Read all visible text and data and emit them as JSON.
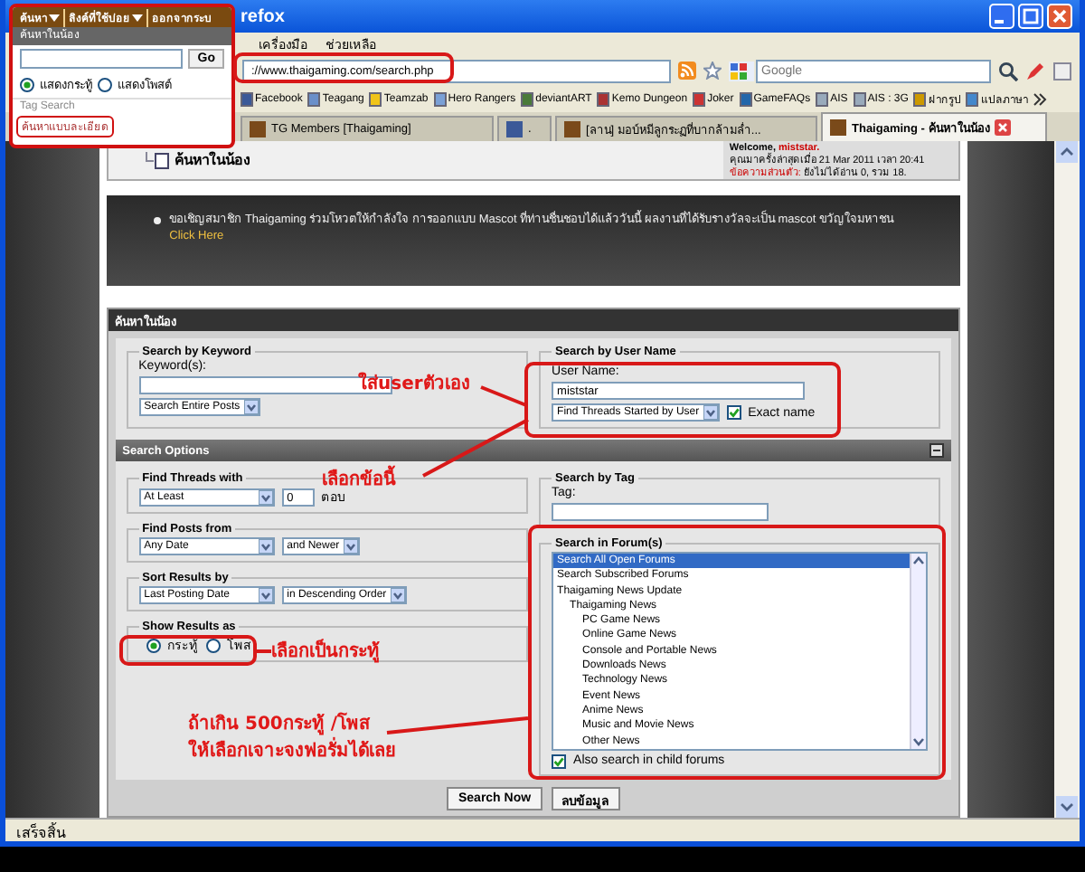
{
  "window": {
    "title": "refox"
  },
  "menu": [
    "เครื่องมือ",
    "ช่วยเหลือ"
  ],
  "address": "://www.thaigaming.com/search.php",
  "search_box": {
    "placeholder": "Google"
  },
  "bookmarks": [
    {
      "label": "Facebook"
    },
    {
      "label": "Teagang"
    },
    {
      "label": "Teamzab"
    },
    {
      "label": "Hero Rangers"
    },
    {
      "label": "deviantART"
    },
    {
      "label": "Kemo Dungeon"
    },
    {
      "label": "Joker"
    },
    {
      "label": "GameFAQs"
    },
    {
      "label": "AIS"
    },
    {
      "label": "AIS : 3G"
    },
    {
      "label": "ฝากรูป"
    },
    {
      "label": "แปลภาษา"
    }
  ],
  "tabs": [
    {
      "label": "TG Members [Thaigaming]",
      "selected": false
    },
    {
      "label": ".",
      "selected": false
    },
    {
      "label": "[ลาน] มอบ์หมีลูกระฏที่บากล้ามล่ำ...",
      "selected": false
    },
    {
      "label": "Thaigaming - ค้นหาในน้อง",
      "selected": true
    }
  ],
  "page": {
    "breadcrumb": "ค้นหาในน้อง",
    "welcome": {
      "greeting": "Welcome,",
      "user": "miststar.",
      "last_visit": "คุณมาครั้งล่าสุดเมื่อ 21 Mar 2011 เวลา 20:41",
      "messages_label": "ข้อความส่วนตัว:",
      "messages": "ยังไม่ได้อ่าน 0, รวม 18."
    },
    "notice": {
      "text": "ขอเชิญสมาชิก Thaigaming ร่วมโหวตให้กำลังใจ การออกแบบ Mascot ที่ท่านชื่นชอบได้แล้ววันนี้ ผลงานที่ได้รับรางวัลจะเป็น mascot ขวัญใจมหาชน",
      "link": "Click Here"
    }
  },
  "form": {
    "title": "ค้นหาในน้อง",
    "keyword": {
      "legend": "Search by Keyword",
      "label": "Keyword(s):",
      "scope": "Search Entire Posts"
    },
    "user": {
      "legend": "Search by User Name",
      "label": "User Name:",
      "value": "miststar",
      "mode": "Find Threads Started by User",
      "exact": {
        "label": "Exact name",
        "checked": true
      }
    },
    "options_title": "Search Options",
    "threads": {
      "legend": "Find Threads with",
      "compare": "At Least",
      "count": "0",
      "unit": "ตอบ"
    },
    "posts_from": {
      "legend": "Find Posts from",
      "date": "Any Date",
      "direction": "and Newer"
    },
    "sort": {
      "legend": "Sort Results by",
      "field": "Last Posting Date",
      "order": "in Descending Order"
    },
    "show_as": {
      "legend": "Show Results as",
      "options": [
        {
          "label": "กระทู้",
          "selected": true
        },
        {
          "label": "โพส",
          "selected": false
        }
      ]
    },
    "tag": {
      "legend": "Search by Tag",
      "label": "Tag:"
    },
    "forums": {
      "legend": "Search in Forum(s)",
      "items": [
        {
          "label": "Search All Open Forums",
          "selected": true
        },
        {
          "label": "Search Subscribed Forums",
          "selected": false
        },
        {
          "label": "Thaigaming News Update",
          "selected": false,
          "children": [
            {
              "label": "Thaigaming News",
              "selected": false,
              "children": [
                {
                  "label": "PC Game News",
                  "selected": false
                },
                {
                  "label": "Online Game News",
                  "selected": false
                },
                {
                  "label": "Console and Portable News",
                  "selected": false
                },
                {
                  "label": "Downloads News",
                  "selected": false
                },
                {
                  "label": "Technology News",
                  "selected": false
                },
                {
                  "label": "Event News",
                  "selected": false
                },
                {
                  "label": "Anime News",
                  "selected": false
                },
                {
                  "label": "Music and Movie News",
                  "selected": false
                },
                {
                  "label": "Other News",
                  "selected": false
                }
              ]
            }
          ]
        }
      ],
      "child": {
        "label": "Also search in child forums",
        "checked": true
      }
    },
    "buttons": [
      "Search Now",
      "ลบข้อมูล"
    ]
  },
  "popup": {
    "menu": [
      {
        "label": "ค้นหา",
        "dropdown": true
      },
      {
        "label": "ลิงค์ที่ใช้บ่อย",
        "dropdown": true
      },
      {
        "label": "ออกจากระบ",
        "dropdown": false
      }
    ],
    "title": "ค้นหาในน้อง",
    "go": "Go",
    "options": [
      {
        "label": "แสดงกระทู้",
        "selected": true
      },
      {
        "label": "แสดงโพสต์",
        "selected": false
      }
    ],
    "tag_search": "Tag Search",
    "advanced": "ค้นหาแบบละเอียด"
  },
  "annotations": [
    {
      "text": "ใส่userตัวเอง"
    },
    {
      "text": "เลือกข้อนี้"
    },
    {
      "text": "เลือกเป็นกระทู้"
    },
    {
      "text": "ถ้าเกิน 500กระทู้ /โพส"
    },
    {
      "text": "ให้เลือกเจาะจงฟอรั่มได้เลย"
    }
  ],
  "status_bar": "เสร็จสิ้น"
}
